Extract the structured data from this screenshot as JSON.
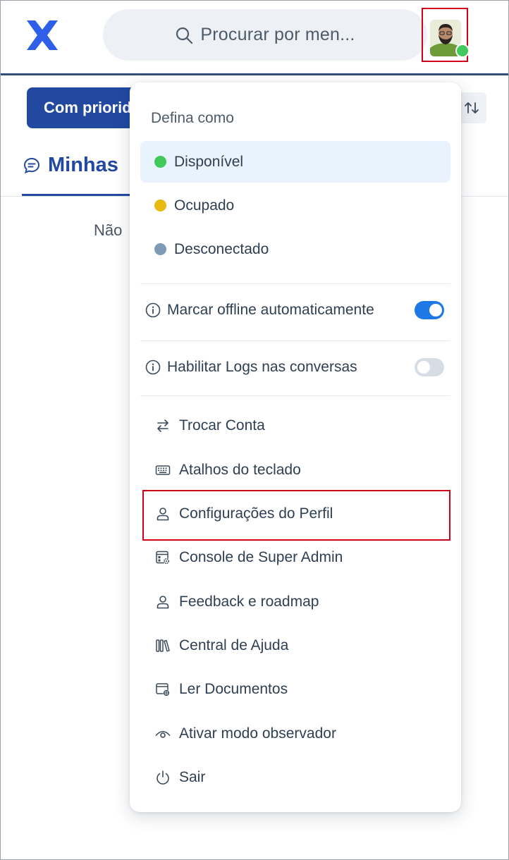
{
  "header": {
    "search_placeholder": "Procurar por men...",
    "status_color": "#42c95b"
  },
  "background": {
    "priority_button": "Com priorid",
    "tab_label": "Minhas",
    "empty_text": "Não"
  },
  "menu": {
    "heading": "Defina como",
    "statuses": [
      {
        "label": "Disponível",
        "color": "#42c95b",
        "active": true
      },
      {
        "label": "Ocupado",
        "color": "#e8b911",
        "active": false
      },
      {
        "label": "Desconectado",
        "color": "#7f9ab5",
        "active": false
      }
    ],
    "toggles": [
      {
        "label": "Marcar offline automaticamente",
        "on": true
      },
      {
        "label": "Habilitar Logs nas conversas",
        "on": false
      }
    ],
    "items": [
      {
        "label": "Trocar Conta",
        "icon": "switch-arrows-icon"
      },
      {
        "label": "Atalhos do teclado",
        "icon": "keyboard-icon"
      },
      {
        "label": "Configurações do Perfil",
        "icon": "person-icon"
      },
      {
        "label": "Console de Super Admin",
        "icon": "admin-console-icon"
      },
      {
        "label": "Feedback e roadmap",
        "icon": "person-icon"
      },
      {
        "label": "Central de Ajuda",
        "icon": "library-icon"
      },
      {
        "label": "Ler Documentos",
        "icon": "documents-icon"
      },
      {
        "label": "Ativar modo observador",
        "icon": "eye-icon"
      },
      {
        "label": "Sair",
        "icon": "power-icon"
      }
    ]
  },
  "colors": {
    "brand": "#2248a0",
    "accent": "#1f78e6"
  }
}
